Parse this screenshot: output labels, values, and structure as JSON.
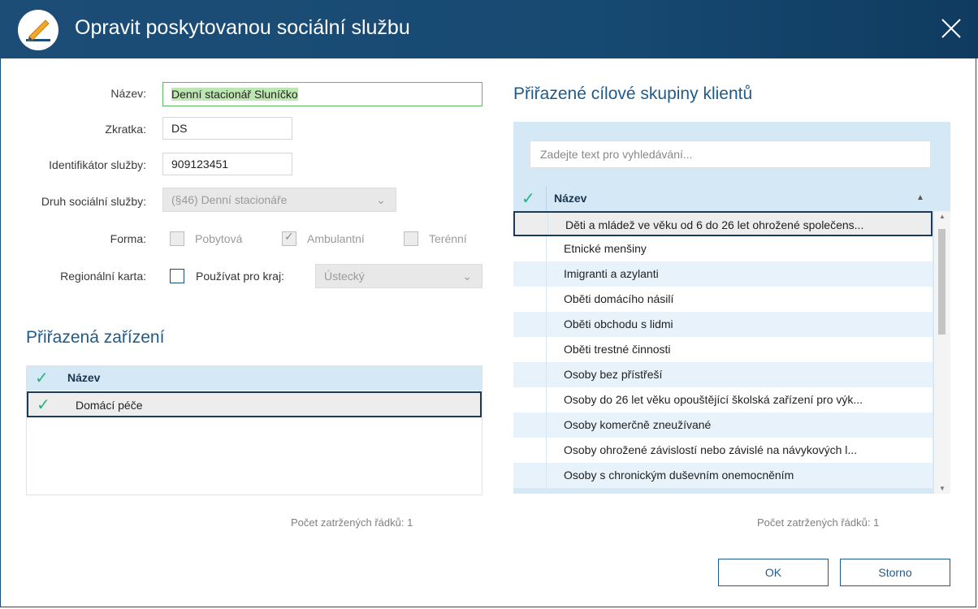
{
  "window": {
    "title": "Opravit poskytovanou sociální službu"
  },
  "form": {
    "name_label": "Název:",
    "name_value": "Denní stacionář Sluníčko",
    "abbr_label": "Zkratka:",
    "abbr_value": "DS",
    "id_label": "Identifikátor služby:",
    "id_value": "909123451",
    "type_label": "Druh sociální služby:",
    "type_value": "(§46) Denní stacionáře",
    "form_label": "Forma:",
    "form_options": [
      {
        "label": "Pobytová",
        "checked": false
      },
      {
        "label": "Ambulantní",
        "checked": true
      },
      {
        "label": "Terénní",
        "checked": false
      }
    ],
    "regional_label": "Regionální karta:",
    "regional_checkbox_label": "Používat pro kraj:",
    "regional_checked": false,
    "region_value": "Ústecký"
  },
  "facilities": {
    "title": "Přiřazená zařízení",
    "column": "Název",
    "rows": [
      "Domácí péče"
    ],
    "count_text": "Počet zatržených řádků: 1"
  },
  "groups": {
    "title": "Přiřazené cílové skupiny klientů",
    "search_placeholder": "Zadejte text pro vyhledávání...",
    "column": "Název",
    "rows": [
      "Děti a mládež ve věku od 6 do 26 let ohrožené společens...",
      "Etnické menšiny",
      "Imigranti a azylanti",
      "Oběti domácího násilí",
      "Oběti obchodu s lidmi",
      "Oběti trestné činnosti",
      "Osoby bez přístřeší",
      "Osoby do 26 let věku opouštějící školská zařízení pro výk...",
      "Osoby komerčně zneužívané",
      "Osoby ohrožené závislostí nebo závislé na návykových l...",
      "Osoby s chronickým duševním onemocněním"
    ],
    "count_text": "Počet zatržených řádků: 1"
  },
  "buttons": {
    "ok": "OK",
    "cancel": "Storno"
  },
  "colors": {
    "titlebar": "#1c4d77",
    "accent": "#1f5b8a",
    "check": "#2ab07f",
    "grid_header": "#d4e8f6"
  }
}
